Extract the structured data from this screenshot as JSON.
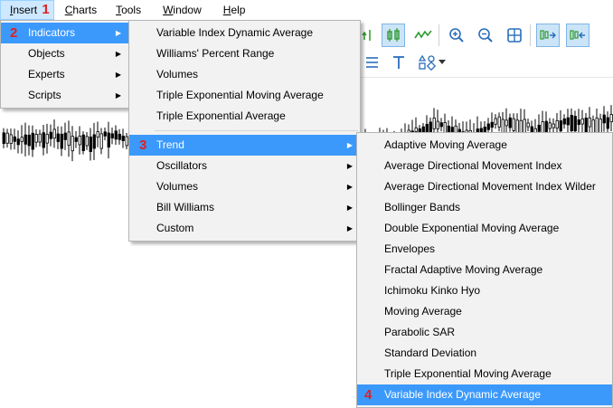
{
  "menubar": {
    "items": [
      {
        "label": "Insert",
        "mnemonic": "I"
      },
      {
        "label": "Charts",
        "mnemonic": "C"
      },
      {
        "label": "Tools",
        "mnemonic": "T"
      },
      {
        "label": "Window",
        "mnemonic": "W"
      },
      {
        "label": "Help",
        "mnemonic": "H"
      }
    ]
  },
  "steps": {
    "one": "1",
    "two": "2",
    "three": "3",
    "four": "4"
  },
  "insert_menu": {
    "items": [
      {
        "label": "Indicators"
      },
      {
        "label": "Objects"
      },
      {
        "label": "Experts"
      },
      {
        "label": "Scripts"
      }
    ]
  },
  "indicators_menu": {
    "recent": [
      {
        "label": "Variable Index Dynamic Average"
      },
      {
        "label": "Williams' Percent Range"
      },
      {
        "label": "Volumes"
      },
      {
        "label": "Triple Exponential Moving Average"
      },
      {
        "label": "Triple Exponential Average"
      }
    ],
    "groups": [
      {
        "label": "Trend"
      },
      {
        "label": "Oscillators"
      },
      {
        "label": "Volumes"
      },
      {
        "label": "Bill Williams"
      },
      {
        "label": "Custom"
      }
    ]
  },
  "trend_menu": {
    "items": [
      {
        "label": "Adaptive Moving Average"
      },
      {
        "label": "Average Directional Movement Index"
      },
      {
        "label": "Average Directional Movement Index Wilder"
      },
      {
        "label": "Bollinger Bands"
      },
      {
        "label": "Double Exponential Moving Average"
      },
      {
        "label": "Envelopes"
      },
      {
        "label": "Fractal Adaptive Moving Average"
      },
      {
        "label": "Ichimoku Kinko Hyo"
      },
      {
        "label": "Moving Average"
      },
      {
        "label": "Parabolic SAR"
      },
      {
        "label": "Standard Deviation"
      },
      {
        "label": "Triple Exponential Moving Average"
      },
      {
        "label": "Variable Index Dynamic Average"
      }
    ]
  },
  "icons": {
    "submenu": "submenu-arrow-icon",
    "toolbar": [
      "line-up-icon",
      "candlestick-icon",
      "line-chart-icon",
      "zoom-in-icon",
      "zoom-out-icon",
      "grid-icon",
      "autoscroll-icon",
      "chart-shift-icon",
      "hline-icon",
      "text-icon",
      "shapes-icon",
      "dropdown-icon"
    ]
  },
  "colors": {
    "highlight": "#3b99fc",
    "badge": "#e02020",
    "menu_bg": "#f2f2f2"
  }
}
